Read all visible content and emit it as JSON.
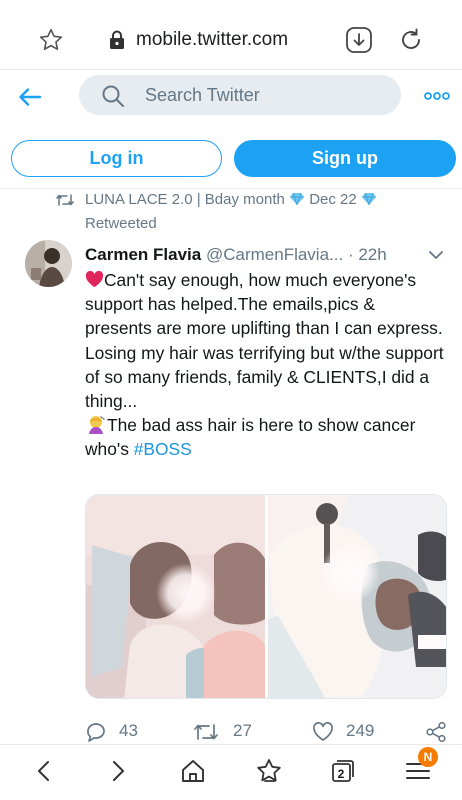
{
  "browser": {
    "url": "mobile.twitter.com",
    "tab_count": "2",
    "menu_badge": "N"
  },
  "header": {
    "search_placeholder": "Search Twitter"
  },
  "auth": {
    "login_label": "Log in",
    "signup_label": "Sign up"
  },
  "retweet_context": {
    "retweeter_name_part1": "LUNA LACE 2.0 | Bday month",
    "retweeter_name_part2": "Dec 22",
    "label": "Retweeted"
  },
  "tweet": {
    "author_name": "Carmen Flavia",
    "author_handle": "@CarmenFlavia...",
    "separator": " · ",
    "time": "22h",
    "text_line1": "Can't say enough, how much everyone's support has helped.The emails,pics & presents are more uplifting than I can express.",
    "text_line2": "Losing my hair was terrifying but w/the support of so many friends, family & CLIENTS,I did a thing...",
    "text_line3": "The bad ass hair is here to show cancer who's ",
    "hashtag": "#BOSS",
    "reply_count": "43",
    "retweet_count": "27",
    "like_count": "249"
  },
  "colors": {
    "twitter_blue": "#1da1f2",
    "secondary_text": "#657786",
    "search_bg": "#e6ecf0",
    "badge_orange": "#f57c00"
  }
}
